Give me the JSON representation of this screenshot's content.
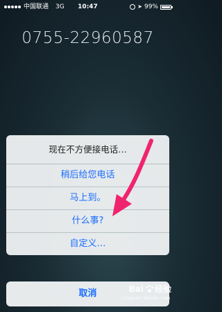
{
  "status_bar": {
    "carrier": "中国联通",
    "network": "3G",
    "time": "10:47",
    "battery_percent": "99%",
    "battery_level": 0.99
  },
  "call": {
    "phone_number": "0755-22960587"
  },
  "action_sheet": {
    "title": "现在不方便接电话…",
    "options": [
      {
        "label": "稍后给您电话"
      },
      {
        "label": "马上到。"
      },
      {
        "label": "什么事?"
      },
      {
        "label": "自定义…"
      }
    ],
    "cancel_label": "取消"
  },
  "watermark": {
    "brand_text": "Bai",
    "brand_text_2": "经验",
    "url": "jingyan.baidu.com"
  },
  "colors": {
    "accent": "#1a6dff",
    "arrow": "#f0246e"
  }
}
